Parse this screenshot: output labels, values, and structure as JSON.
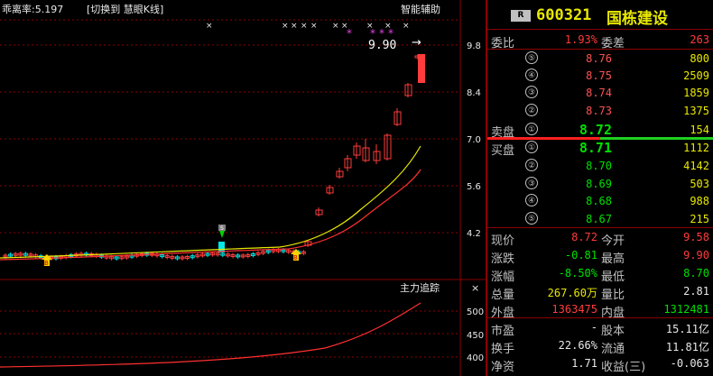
{
  "chart_header": {
    "bias_label": "乖离率:5.197",
    "switch_link": "[切换到 慧眼K线]",
    "smart_aid": "智能辅助"
  },
  "price_axis": [
    "9.8",
    "8.4",
    "7.0",
    "5.6",
    "4.2"
  ],
  "last_price_mark": "9.90",
  "last_price_arrow": "→",
  "sub_panel": {
    "title": "主力追踪",
    "close_glyph": "×",
    "axis": [
      "500",
      "450",
      "400"
    ]
  },
  "markers": {
    "x_glyph": "×",
    "star_glyph": "*",
    "s_marker": "S",
    "b_marker": "B"
  },
  "quote": {
    "badge": "R",
    "code": "600321",
    "name": "国栋建设",
    "weibi_label": "委比",
    "weibi_value": "1.93%",
    "weicha_label": "委差",
    "weicha_value": "263",
    "sell_label": "卖盘",
    "buy_label": "买盘",
    "asks": [
      {
        "level": "⑤",
        "price": "8.76",
        "vol": "800"
      },
      {
        "level": "④",
        "price": "8.75",
        "vol": "2509"
      },
      {
        "level": "③",
        "price": "8.74",
        "vol": "1859"
      },
      {
        "level": "②",
        "price": "8.73",
        "vol": "1375"
      },
      {
        "level": "①",
        "price": "8.72",
        "vol": "154"
      }
    ],
    "bids": [
      {
        "level": "①",
        "price": "8.71",
        "vol": "1112"
      },
      {
        "level": "②",
        "price": "8.70",
        "vol": "4142"
      },
      {
        "level": "③",
        "price": "8.69",
        "vol": "503"
      },
      {
        "level": "④",
        "price": "8.68",
        "vol": "988"
      },
      {
        "level": "⑤",
        "price": "8.67",
        "vol": "215"
      }
    ],
    "stats": [
      {
        "l1": "现价",
        "v1": "8.72",
        "c1": "red",
        "l2": "今开",
        "v2": "9.58",
        "c2": "red"
      },
      {
        "l1": "涨跌",
        "v1": "-0.81",
        "c1": "grn",
        "l2": "最高",
        "v2": "9.90",
        "c2": "red"
      },
      {
        "l1": "涨幅",
        "v1": "-8.50%",
        "c1": "grn",
        "l2": "最低",
        "v2": "8.70",
        "c2": "grn"
      },
      {
        "l1": "总量",
        "v1": "267.60万",
        "c1": "yel",
        "l2": "量比",
        "v2": "2.81",
        "c2": "wht"
      },
      {
        "l1": "外盘",
        "v1": "1363475",
        "c1": "red",
        "l2": "内盘",
        "v2": "1312481",
        "c2": "grn"
      },
      {
        "l1": "市盈",
        "v1": "-",
        "c1": "wht",
        "l2": "股本",
        "v2": "15.11亿",
        "c2": "wht"
      },
      {
        "l1": "换手",
        "v1": "22.66%",
        "c1": "wht",
        "l2": "流通",
        "v2": "11.81亿",
        "c2": "wht"
      },
      {
        "l1": "净资",
        "v1": "1.71",
        "c1": "wht",
        "l2": "收益(三)",
        "v2": "-0.063",
        "c2": "wht"
      }
    ]
  },
  "colors": {
    "up": "#ff3c3c",
    "down": "#00e0e0",
    "ma_yellow": "#e8e800",
    "ma_red": "#ff3030",
    "grid": "#8b0000"
  }
}
